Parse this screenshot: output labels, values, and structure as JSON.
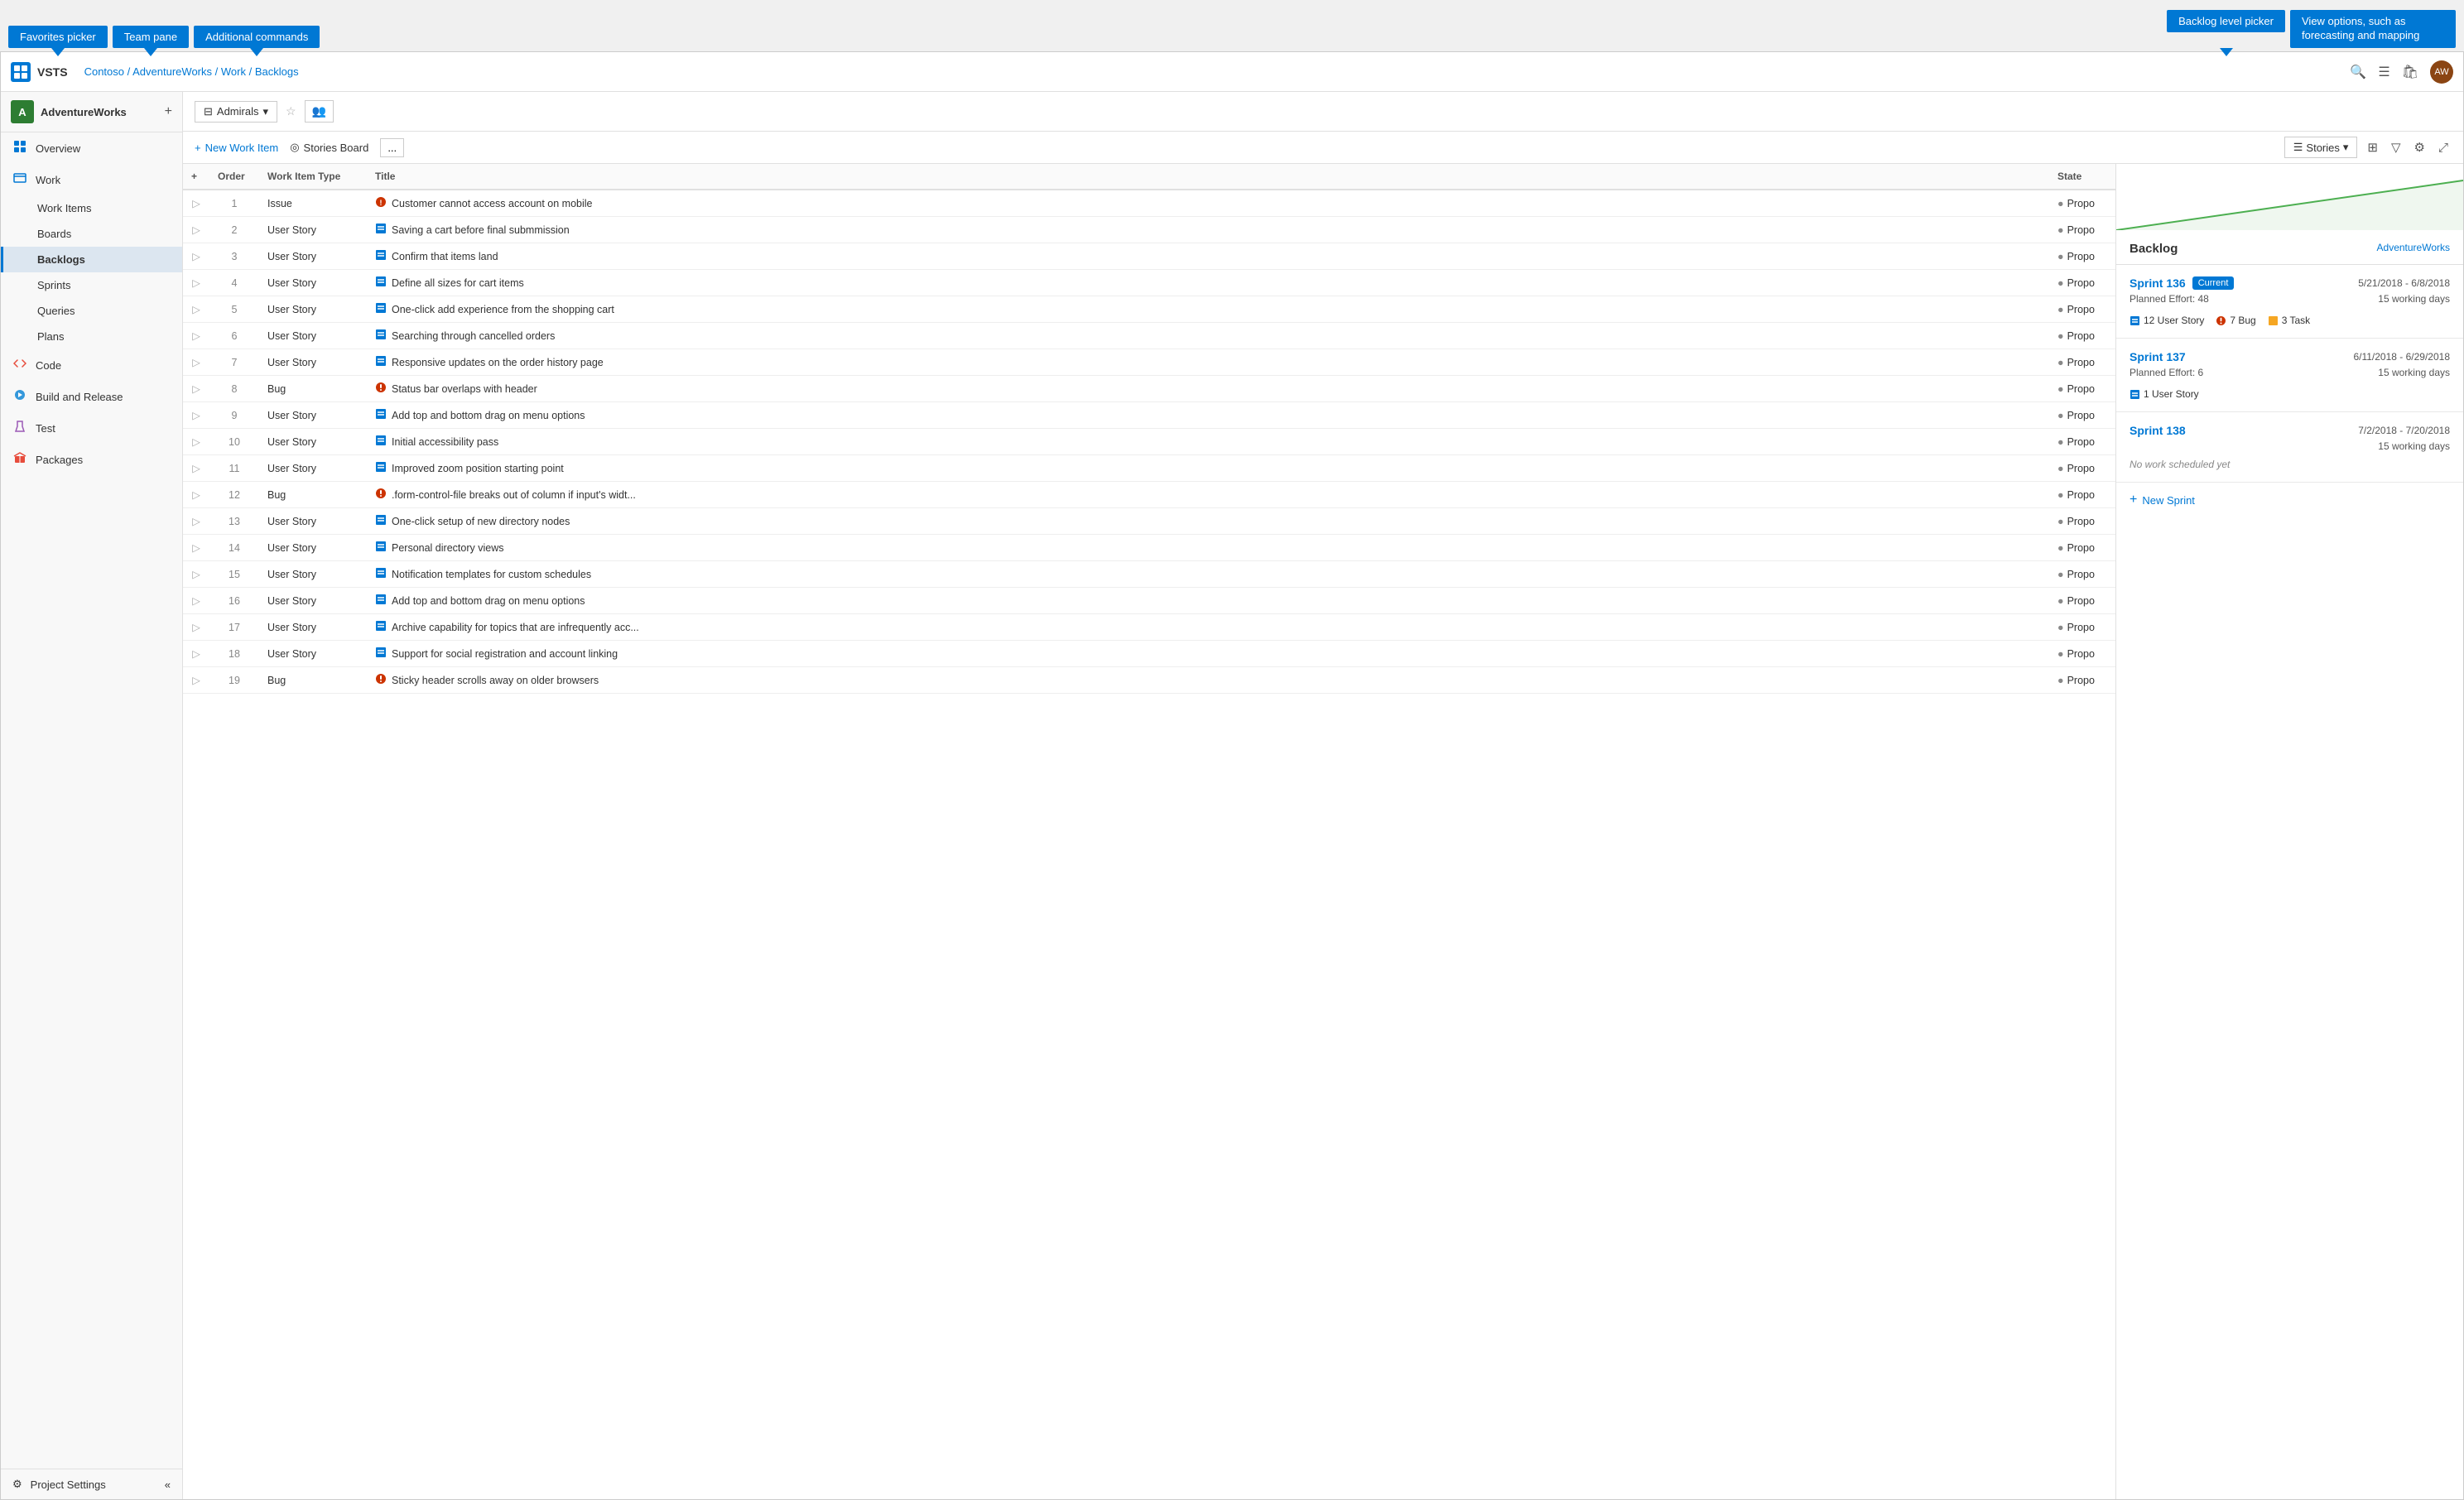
{
  "tooltips": {
    "favorites_picker": "Favorites picker",
    "team_pane": "Team pane",
    "additional_commands": "Additional commands",
    "backlog_level_picker": "Backlog level picker",
    "view_options": "View options, such as forecasting and mapping"
  },
  "header": {
    "logo": "V",
    "app_title": "VSTS",
    "breadcrumb": [
      "Contoso",
      "AdventureWorks",
      "Work",
      "Backlogs"
    ],
    "avatar_initials": "AW"
  },
  "sidebar": {
    "project_name": "AdventureWorks",
    "project_icon": "A",
    "nav_items": [
      {
        "id": "overview",
        "label": "Overview",
        "icon": "⊞"
      },
      {
        "id": "work",
        "label": "Work",
        "icon": "📋"
      },
      {
        "id": "work-items",
        "label": "Work Items",
        "icon": "☰",
        "sub": true
      },
      {
        "id": "boards",
        "label": "Boards",
        "icon": "⊞",
        "sub": true
      },
      {
        "id": "backlogs",
        "label": "Backlogs",
        "icon": "≡",
        "sub": true,
        "active": true
      },
      {
        "id": "sprints",
        "label": "Sprints",
        "icon": "◷",
        "sub": true
      },
      {
        "id": "queries",
        "label": "Queries",
        "icon": "⚡",
        "sub": true
      },
      {
        "id": "plans",
        "label": "Plans",
        "icon": "☰",
        "sub": true
      },
      {
        "id": "code",
        "label": "Code",
        "icon": "⟨⟩"
      },
      {
        "id": "build-release",
        "label": "Build and Release",
        "icon": "🚀"
      },
      {
        "id": "test",
        "label": "Test",
        "icon": "⚗"
      },
      {
        "id": "packages",
        "label": "Packages",
        "icon": "📦"
      }
    ],
    "settings_label": "Project Settings",
    "collapse_label": "«"
  },
  "toolbar": {
    "team_picker_label": "Admirals",
    "team_picker_icon": "⊟",
    "new_work_item_label": "New Work Item",
    "stories_board_label": "Stories Board",
    "more_label": "...",
    "stories_label": "Stories",
    "filter_icon": "⊟",
    "settings_icon": "⚙",
    "expand_icon": "⤢"
  },
  "backlog": {
    "columns": [
      {
        "id": "expand",
        "label": ""
      },
      {
        "id": "order",
        "label": "Order"
      },
      {
        "id": "type",
        "label": "Work Item Type"
      },
      {
        "id": "title",
        "label": "Title"
      },
      {
        "id": "state",
        "label": "State"
      }
    ],
    "rows": [
      {
        "order": 1,
        "type": "Issue",
        "type_icon": "issue",
        "title": "Customer cannot access account on mobile",
        "state": "Propo"
      },
      {
        "order": 2,
        "type": "User Story",
        "type_icon": "story",
        "title": "Saving a cart before final submmission",
        "state": "Propo"
      },
      {
        "order": 3,
        "type": "User Story",
        "type_icon": "story",
        "title": "Confirm that items land",
        "state": "Propo"
      },
      {
        "order": 4,
        "type": "User Story",
        "type_icon": "story",
        "title": "Define all sizes for cart items",
        "state": "Propo"
      },
      {
        "order": 5,
        "type": "User Story",
        "type_icon": "story",
        "title": "One-click add experience from the shopping cart",
        "state": "Propo"
      },
      {
        "order": 6,
        "type": "User Story",
        "type_icon": "story",
        "title": "Searching through cancelled orders",
        "state": "Propo"
      },
      {
        "order": 7,
        "type": "User Story",
        "type_icon": "story",
        "title": "Responsive updates on the order history page",
        "state": "Propo"
      },
      {
        "order": 8,
        "type": "Bug",
        "type_icon": "bug",
        "title": "Status bar overlaps with header",
        "state": "Propo"
      },
      {
        "order": 9,
        "type": "User Story",
        "type_icon": "story",
        "title": "Add top and bottom drag on menu options",
        "state": "Propo"
      },
      {
        "order": 10,
        "type": "User Story",
        "type_icon": "story",
        "title": "Initial accessibility pass",
        "state": "Propo"
      },
      {
        "order": 11,
        "type": "User Story",
        "type_icon": "story",
        "title": "Improved zoom position starting point",
        "state": "Propo"
      },
      {
        "order": 12,
        "type": "Bug",
        "type_icon": "bug",
        "title": ".form-control-file breaks out of column if input's widt...",
        "state": "Propo"
      },
      {
        "order": 13,
        "type": "User Story",
        "type_icon": "story",
        "title": "One-click setup of new directory nodes",
        "state": "Propo"
      },
      {
        "order": 14,
        "type": "User Story",
        "type_icon": "story",
        "title": "Personal directory views",
        "state": "Propo"
      },
      {
        "order": 15,
        "type": "User Story",
        "type_icon": "story",
        "title": "Notification templates for custom schedules",
        "state": "Propo"
      },
      {
        "order": 16,
        "type": "User Story",
        "type_icon": "story",
        "title": "Add top and bottom drag on menu options",
        "state": "Propo"
      },
      {
        "order": 17,
        "type": "User Story",
        "type_icon": "story",
        "title": "Archive capability for topics that are infrequently acc...",
        "state": "Propo"
      },
      {
        "order": 18,
        "type": "User Story",
        "type_icon": "story",
        "title": "Support for social registration and account linking",
        "state": "Propo"
      },
      {
        "order": 19,
        "type": "Bug",
        "type_icon": "bug",
        "title": "Sticky header scrolls away on older browsers",
        "state": "Propo"
      }
    ]
  },
  "right_panel": {
    "title": "Backlog",
    "org": "AdventureWorks",
    "sprints": [
      {
        "name": "Sprint 136",
        "is_current": true,
        "current_label": "Current",
        "date_range": "5/21/2018 - 6/8/2018",
        "planned_effort": "Planned Effort: 48",
        "working_days": "15 working days",
        "items": [
          {
            "count": 12,
            "type": "User Story",
            "badge_class": "badge-story"
          },
          {
            "count": 7,
            "type": "Bug",
            "badge_class": "badge-bug"
          },
          {
            "count": 3,
            "type": "Task",
            "badge_class": "badge-task"
          }
        ]
      },
      {
        "name": "Sprint 137",
        "is_current": false,
        "date_range": "6/11/2018 - 6/29/2018",
        "planned_effort": "Planned Effort: 6",
        "working_days": "15 working days",
        "items": [
          {
            "count": 1,
            "type": "User Story",
            "badge_class": "badge-story"
          }
        ]
      },
      {
        "name": "Sprint 138",
        "is_current": false,
        "date_range": "7/2/2018 - 7/20/2018",
        "working_days": "15 working days",
        "items": [],
        "no_work": "No work scheduled yet"
      }
    ],
    "new_sprint_label": "+ New Sprint"
  }
}
